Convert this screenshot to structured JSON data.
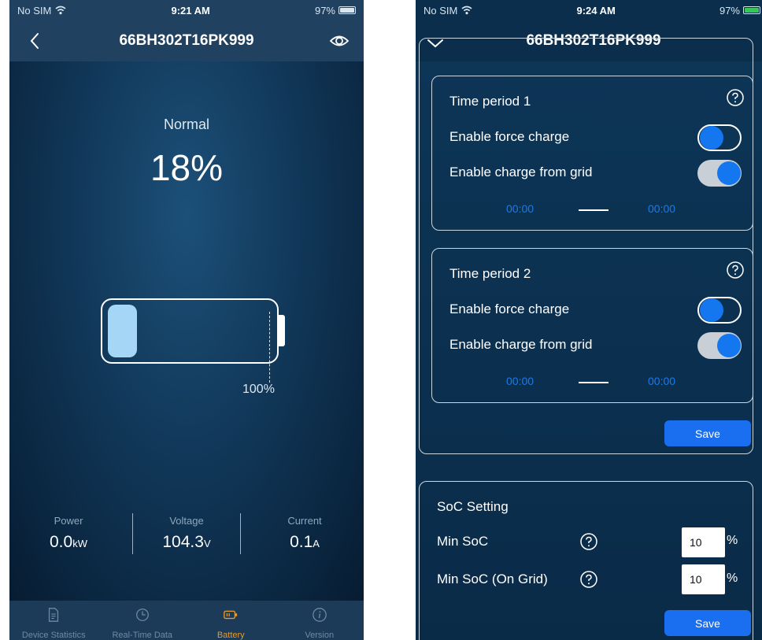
{
  "left_screen": {
    "status_bar": {
      "carrier": "No SIM",
      "time": "9:21 AM",
      "battery": "97%"
    },
    "nav": {
      "title": "66BH302T16PK999",
      "back_icon": "chevron-left-icon",
      "right_icon": "eye-icon"
    },
    "battery": {
      "status": "Normal",
      "percent": "18%",
      "level_fraction": 0.18,
      "full_marker_label": "100%",
      "fill_color": "#a5d6f5"
    },
    "metrics": [
      {
        "label": "Power",
        "value": "0.0",
        "unit": "kW"
      },
      {
        "label": "Voltage",
        "value": "104.3",
        "unit": "V"
      },
      {
        "label": "Current",
        "value": "0.1",
        "unit": "A"
      }
    ],
    "tabs": [
      {
        "label": "Device Statistics",
        "icon": "document-icon",
        "active": false
      },
      {
        "label": "Real-Time Data",
        "icon": "clock-icon",
        "active": false
      },
      {
        "label": "Battery",
        "icon": "battery-icon",
        "active": true
      },
      {
        "label": "Version",
        "icon": "info-icon",
        "active": false
      }
    ],
    "colors": {
      "active_tab": "#e39b2e",
      "inactive_tab": "#6f8aa3"
    }
  },
  "right_screen": {
    "status_bar": {
      "carrier": "No SIM",
      "time": "9:24 AM",
      "battery": "97%"
    },
    "nav": {
      "title": "66BH302T16PK999",
      "left_icon": "chevron-down-icon"
    },
    "periods": [
      {
        "title": "Time period 1",
        "force_charge_label": "Enable force charge",
        "force_charge_on": false,
        "grid_charge_label": "Enable charge from grid",
        "grid_charge_on": true,
        "start_time": "00:00",
        "end_time": "00:00"
      },
      {
        "title": "Time period 2",
        "force_charge_label": "Enable force charge",
        "force_charge_on": false,
        "grid_charge_label": "Enable charge from grid",
        "grid_charge_on": true,
        "start_time": "00:00",
        "end_time": "00:00"
      }
    ],
    "save_label": "Save",
    "soc": {
      "title": "SoC Setting",
      "min_soc_label": "Min SoC",
      "min_soc_value": "10",
      "min_soc_grid_label": "Min SoC (On Grid)",
      "min_soc_grid_value": "10",
      "unit": "%",
      "save_label": "Save"
    },
    "colors": {
      "accent": "#1a6ff0",
      "battery_green": "#34c759"
    }
  }
}
